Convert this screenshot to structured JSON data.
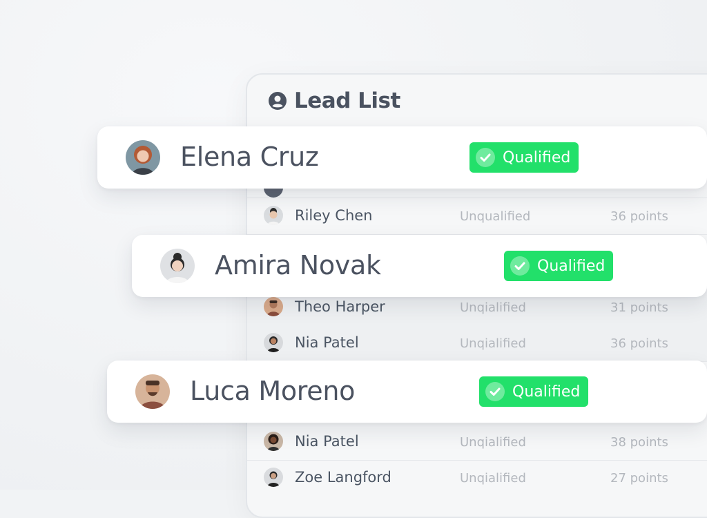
{
  "panel": {
    "title": "Lead List",
    "icon": "user-circle-icon"
  },
  "featured": [
    {
      "name": "Elena Cruz",
      "status": "Qualified"
    },
    {
      "name": "Amira Novak",
      "status": "Qualified"
    },
    {
      "name": "Luca Moreno",
      "status": "Qualified"
    }
  ],
  "rows": [
    {
      "name": "Riley Chen",
      "status": "Unqualified",
      "points": "36 points"
    },
    {
      "name": "Theo Harper",
      "status": "Unqialified",
      "points": "31 points"
    },
    {
      "name": "Nia Patel",
      "status": "Unqialified",
      "points": "36 points"
    },
    {
      "name": "Nia Patel",
      "status": "Unqialified",
      "points": "38 points"
    },
    {
      "name": "Zoe Langford",
      "status": "Unqialified",
      "points": "27 points"
    }
  ],
  "colors": {
    "qualified": "#22e06a",
    "text": "#4b5563",
    "muted": "#b4b8be"
  }
}
